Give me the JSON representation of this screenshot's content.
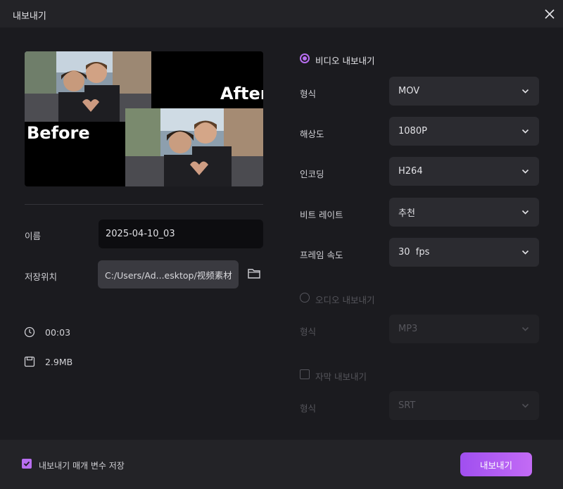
{
  "window": {
    "title": "내보내기"
  },
  "preview": {
    "after_label": "After",
    "before_label": "Before"
  },
  "left": {
    "name_label": "이름",
    "name_value": "2025-04-10_03",
    "location_label": "저장위치",
    "location_value": "C:/Users/Ad...esktop/视频素材",
    "duration": "00:03",
    "size": "2.9MB"
  },
  "video": {
    "title": "비디오 내보내기",
    "selected": true,
    "fields": [
      {
        "label": "형식",
        "value": "MOV"
      },
      {
        "label": "해상도",
        "value": "1080P"
      },
      {
        "label": "인코딩",
        "value": "H264"
      },
      {
        "label": "비트 레이트",
        "value": "추천"
      },
      {
        "label": "프레임 속도",
        "value": "30  fps"
      }
    ]
  },
  "audio": {
    "title": "오디오 내보내기",
    "selected": false,
    "format_label": "형식",
    "format_value": "MP3"
  },
  "subtitle": {
    "title": "자막 내보내기",
    "checked": false,
    "format_label": "형식",
    "format_value": "SRT"
  },
  "footer": {
    "remember_label": "내보내기 매개 변수 저장",
    "remember_checked": true,
    "export_label": "내보내기"
  },
  "colors": {
    "accent": "#b86ef0",
    "background": "#1b1b1f",
    "panel": "#232327"
  },
  "icons": [
    "close-icon",
    "folder-icon",
    "clock-icon",
    "disk-icon",
    "chevron-down-icon",
    "check-icon"
  ]
}
